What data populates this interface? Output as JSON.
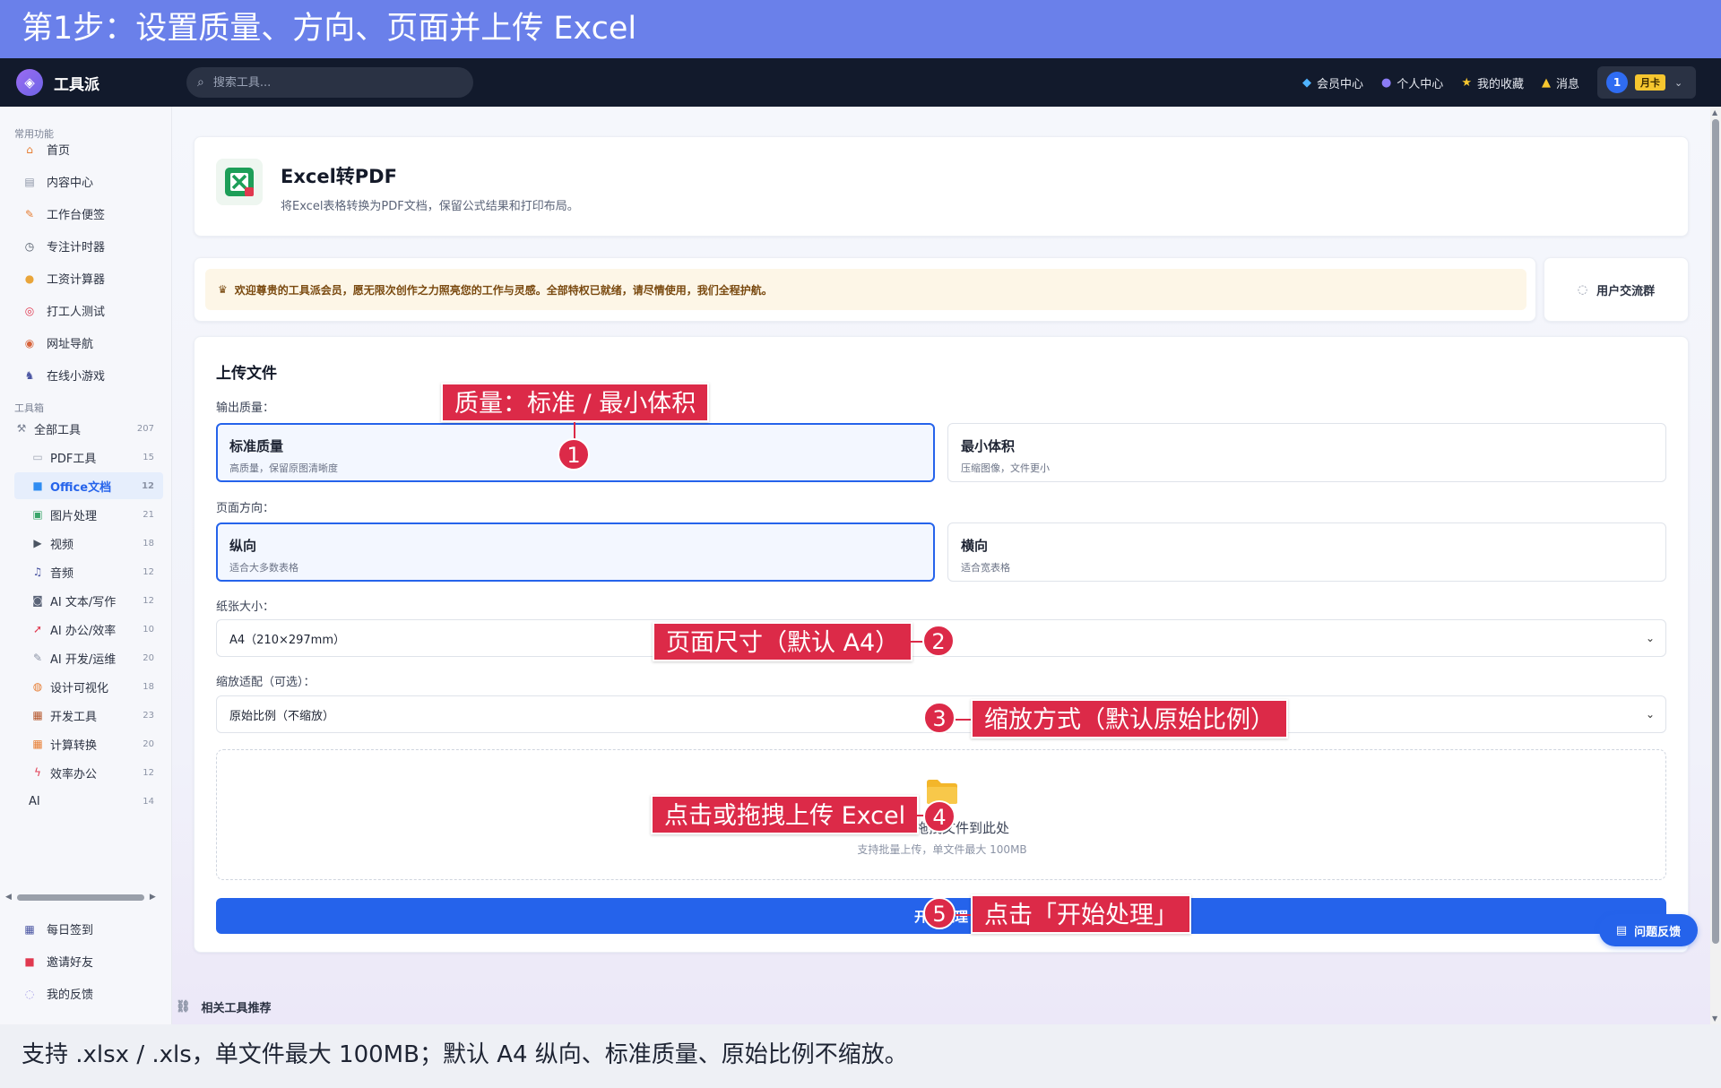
{
  "banner": {
    "top": "第1步：设置质量、方向、页面并上传 Excel",
    "bottom": "支持 .xlsx / .xls，单文件最大 100MB；默认 A4 纵向、标准质量、原始比例不缩放。"
  },
  "navbar": {
    "logo_text": "工具派",
    "search_placeholder": "搜索工具...",
    "links": [
      {
        "icon": "diamond-icon",
        "label": "会员中心"
      },
      {
        "icon": "user-icon",
        "label": "个人中心"
      },
      {
        "icon": "star-icon",
        "label": "我的收藏"
      },
      {
        "icon": "bell-icon",
        "label": "消息"
      }
    ],
    "avatar_text": "1",
    "card_tag": "月卡"
  },
  "sidebar": {
    "common_title": "常用功能",
    "common": [
      {
        "icon": "home-icon",
        "label": "首页"
      },
      {
        "icon": "content-icon",
        "label": "内容中心"
      },
      {
        "icon": "note-icon",
        "label": "工作台便签"
      },
      {
        "icon": "timer-icon",
        "label": "专注计时器"
      },
      {
        "icon": "salary-icon",
        "label": "工资计算器"
      },
      {
        "icon": "target-icon",
        "label": "打工人测试"
      },
      {
        "icon": "compass-icon",
        "label": "网址导航"
      },
      {
        "icon": "gamepad-icon",
        "label": "在线小游戏"
      }
    ],
    "tools_title": "工具箱",
    "all_tools": {
      "label": "全部工具",
      "count": "207"
    },
    "tools": [
      {
        "icon": "pdf-icon",
        "label": "PDF工具",
        "count": "15"
      },
      {
        "icon": "office-icon",
        "label": "Office文档",
        "count": "12"
      },
      {
        "icon": "image-icon",
        "label": "图片处理",
        "count": "21"
      },
      {
        "icon": "video-icon",
        "label": "视频",
        "count": "18"
      },
      {
        "icon": "music-icon",
        "label": "音频",
        "count": "12"
      },
      {
        "icon": "robot-icon",
        "label": "AI 文本/写作",
        "count": "12"
      },
      {
        "icon": "rocket-icon",
        "label": "AI 办公/效率",
        "count": "10"
      },
      {
        "icon": "wrench-icon",
        "label": "AI 开发/运维",
        "count": "20"
      },
      {
        "icon": "palette-icon",
        "label": "设计可视化",
        "count": "18"
      },
      {
        "icon": "toolbox-icon",
        "label": "开发工具",
        "count": "23"
      },
      {
        "icon": "calculator-icon",
        "label": "计算转换",
        "count": "20"
      },
      {
        "icon": "bolt-icon",
        "label": "效率办公",
        "count": "12"
      }
    ],
    "ai_item": {
      "label": "AI",
      "count": "14"
    },
    "bottom": [
      {
        "icon": "calendar-icon",
        "label": "每日签到"
      },
      {
        "icon": "gift-icon",
        "label": "邀请好友"
      },
      {
        "icon": "chat-icon",
        "label": "我的反馈"
      }
    ]
  },
  "tool": {
    "title": "Excel转PDF",
    "desc": "将Excel表格转换为PDF文档，保留公式结果和打印布局。"
  },
  "welcome": "欢迎尊贵的工具派会员，愿无限次创作之力照亮您的工作与灵感。全部特权已就绪，请尽情使用，我们全程护航。",
  "user_group": "用户交流群",
  "upload": {
    "heading": "上传文件",
    "quality_label": "输出质量：",
    "quality_options": [
      {
        "title": "标准质量",
        "sub": "高质量，保留原图清晰度"
      },
      {
        "title": "最小体积",
        "sub": "压缩图像，文件更小"
      }
    ],
    "orientation_label": "页面方向：",
    "orientation_options": [
      {
        "title": "纵向",
        "sub": "适合大多数表格"
      },
      {
        "title": "横向",
        "sub": "适合宽表格"
      }
    ],
    "paper_label": "纸张大小：",
    "paper_value": "A4（210×297mm）",
    "scale_label": "缩放适配（可选）：",
    "scale_value": "原始比例（不缩放）",
    "drop_text": "点击或拖拽文件到此处",
    "drop_sub": "支持批量上传，单文件最大 100MB",
    "start_button": "开始处理"
  },
  "related": "相关工具推荐",
  "feedback": "问题反馈",
  "annotations": [
    {
      "num": "1",
      "text": "质量：标准 / 最小体积"
    },
    {
      "num": "2",
      "text": "页面尺寸（默认 A4）"
    },
    {
      "num": "3",
      "text": "缩放方式（默认原始比例）"
    },
    {
      "num": "4",
      "text": "点击或拖拽上传 Excel"
    },
    {
      "num": "5",
      "text": "点击「开始处理」"
    }
  ],
  "colors": {
    "banner": "#6a80ea",
    "navbar": "#121a2c",
    "primary": "#2563eb",
    "annotation": "#dc2a48",
    "card_tag": "#f6c62f"
  }
}
